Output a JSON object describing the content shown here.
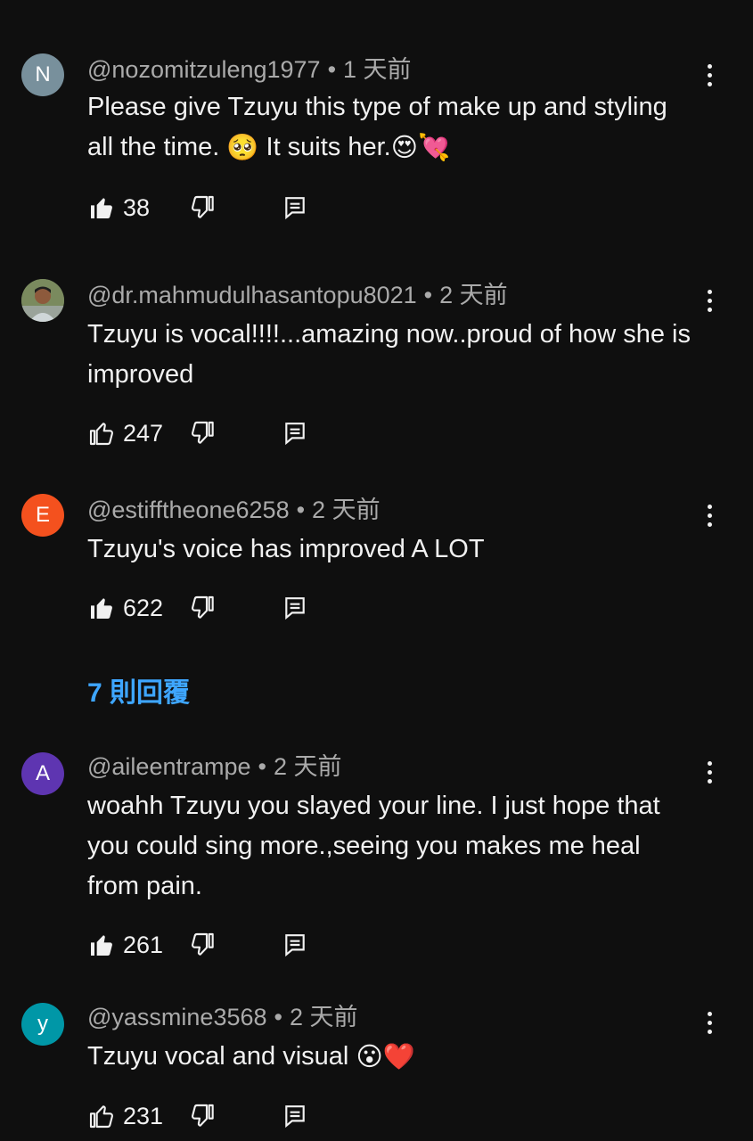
{
  "comments": [
    {
      "avatar_letter": "N",
      "avatar_color": "#78909c",
      "handle": "@nozomitzuleng1977",
      "time": "1 天前",
      "text": "Please give Tzuyu this type of make up and styling all the time. 🥺 It suits her.😍💘",
      "likes": "38",
      "liked": true
    },
    {
      "avatar_letter": "",
      "avatar_color": "#4a5a3a",
      "handle": "@dr.mahmudulhasantopu8021",
      "time": "2 天前",
      "text": "Tzuyu is vocal!!!!...amazing now..proud of how she is improved",
      "likes": "247",
      "liked": false
    },
    {
      "avatar_letter": "E",
      "avatar_color": "#f4511e",
      "handle": "@estifftheone6258",
      "time": "2 天前",
      "text": "Tzuyu's voice has improved A LOT",
      "likes": "622",
      "liked": true
    },
    {
      "avatar_letter": "A",
      "avatar_color": "#5e35b1",
      "handle": "@aileentrampe",
      "time": "2 天前",
      "text": "woahh Tzuyu you slayed your line. I just hope that you could sing more.,seeing you makes me heal from pain.",
      "likes": "261",
      "liked": true
    },
    {
      "avatar_letter": "y",
      "avatar_color": "#0097a7",
      "handle": "@yassmine3568",
      "time": "2 天前",
      "text": "Tzuyu vocal and visual 😮❤️",
      "likes": "231",
      "liked": false
    }
  ],
  "replies_label": "7 則回覆",
  "colors": {
    "background": "#0f0f0f",
    "link": "#3ea6ff",
    "meta": "#aaaaaa"
  }
}
